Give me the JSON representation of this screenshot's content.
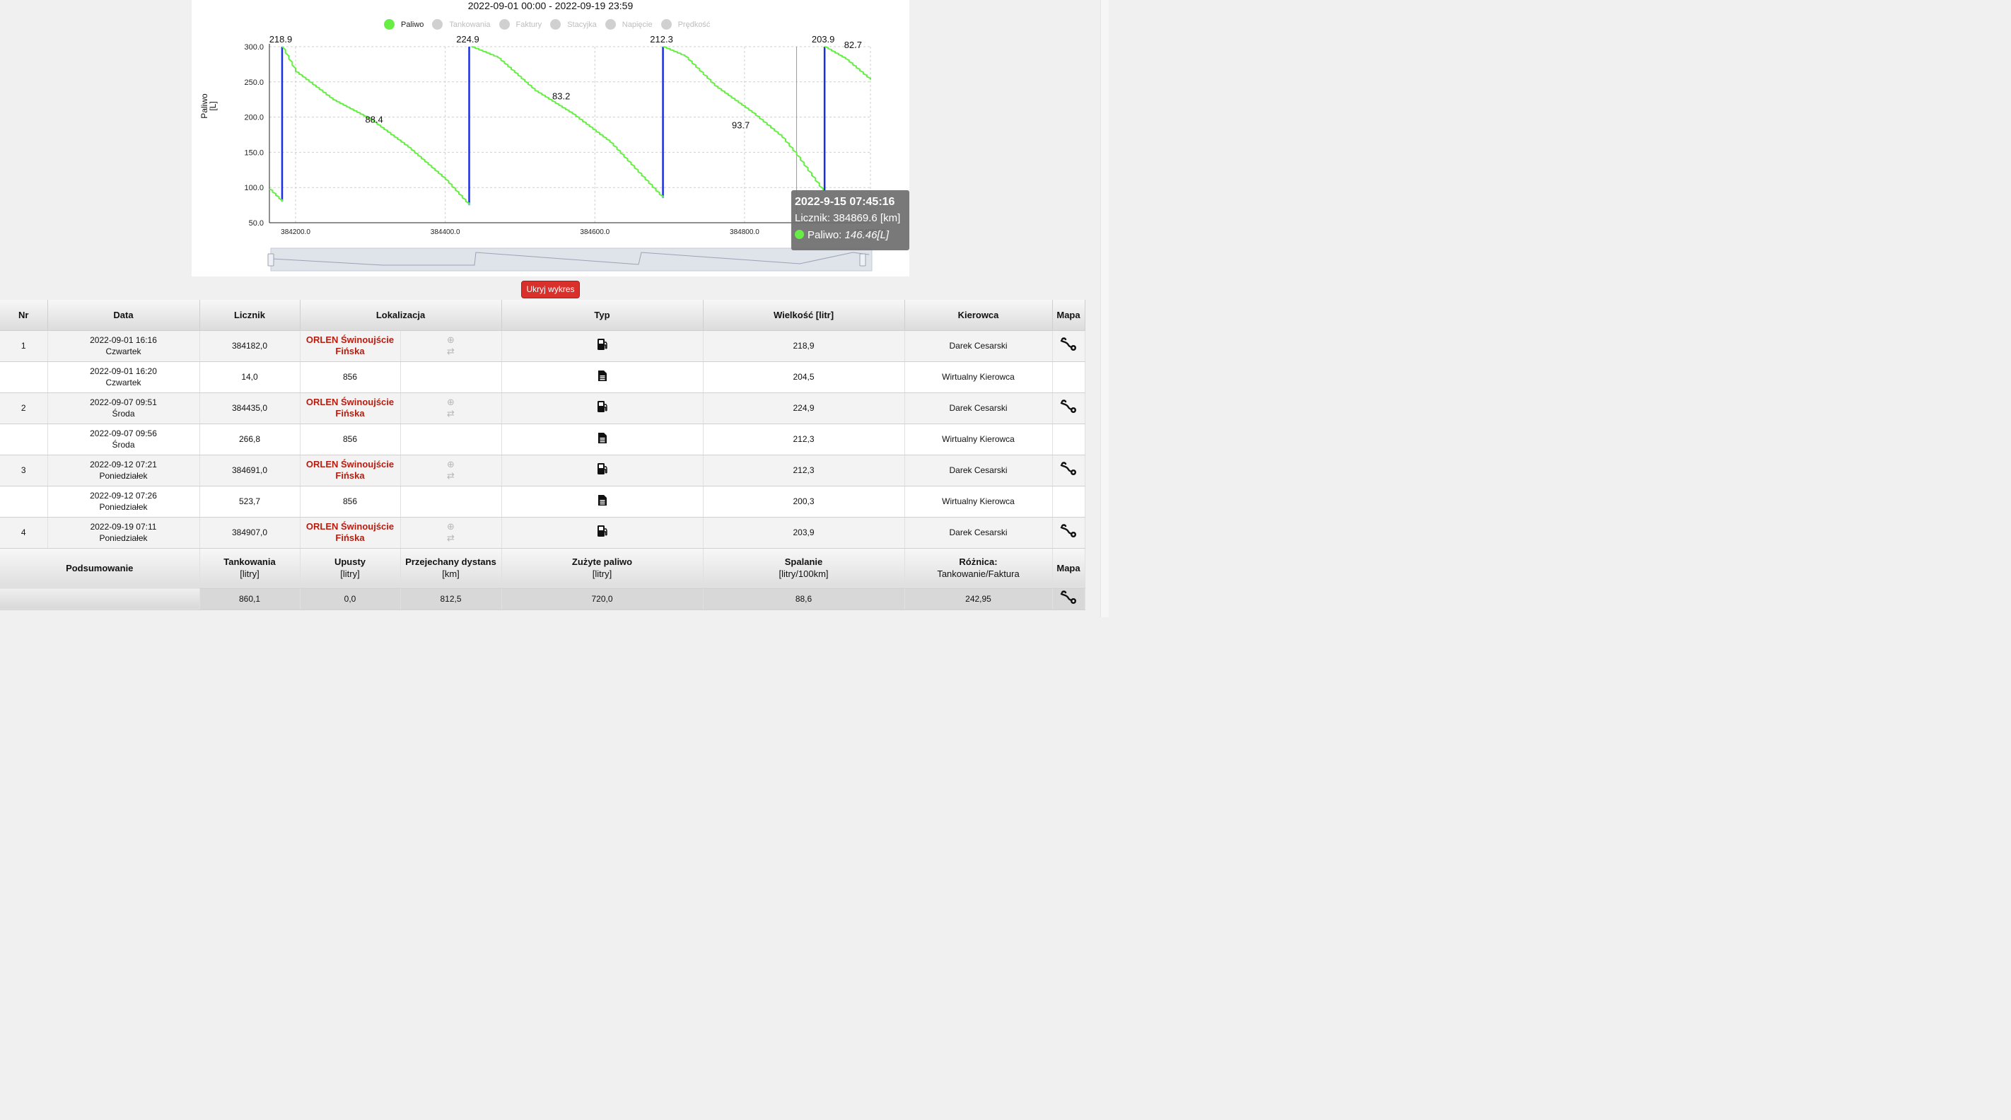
{
  "chart": {
    "title": "2022-09-01 00:00 - 2022-09-19 23:59",
    "legend": [
      {
        "label": "Paliwo",
        "active": true
      },
      {
        "label": "Tankowania",
        "active": false
      },
      {
        "label": "Faktury",
        "active": false
      },
      {
        "label": "Stacyjka",
        "active": false
      },
      {
        "label": "Napięcie",
        "active": false
      },
      {
        "label": "Prędkość",
        "active": false
      }
    ],
    "y_axis_title_line1": "Paliwo",
    "y_axis_title_line2": "[L]",
    "hide_button": "Ukryj wykres",
    "tooltip": {
      "title": "2022-9-15 07:45:16",
      "licznik": "Licznik: 384869.6 [km]",
      "paliwo_label": "Paliwo: ",
      "paliwo_value": "146.46[L]"
    }
  },
  "chart_data": {
    "type": "line",
    "xlabel": "",
    "ylabel": "Paliwo [L]",
    "xlim": [
      384165,
      384968.3
    ],
    "ylim": [
      50,
      300
    ],
    "xticks": [
      "384200.0",
      "384400.0",
      "384600.0",
      "384800.0",
      "384968.3"
    ],
    "yticks": [
      "50.0",
      "100.0",
      "150.0",
      "200.0",
      "250.0",
      "300.0"
    ],
    "series": [
      {
        "name": "Paliwo",
        "color": "#66ee44",
        "segments": [
          {
            "x": [
              384165,
              384182
            ],
            "y": [
              98,
              80
            ]
          },
          {
            "x": [
              384182,
              384200,
              384250,
              384300,
              384350,
              384400,
              384432
            ],
            "y": [
              300,
              265,
              225,
              197,
              158,
              112,
              75
            ]
          },
          {
            "x": [
              384435,
              384470,
              384520,
              384570,
              384620,
              384691
            ],
            "y": [
              300,
              285,
              238,
              205,
              165,
              85
            ]
          },
          {
            "x": [
              384691,
              384720,
              384760,
              384810,
              384850,
              384869.6,
              384905
            ],
            "y": [
              300,
              287,
              245,
              207,
              172,
              146.46,
              95
            ]
          },
          {
            "x": [
              384907,
              384935,
              384968.3
            ],
            "y": [
              300,
              283,
              253
            ]
          }
        ]
      }
    ],
    "refuel_lines": [
      {
        "x": 384182,
        "y0": 80,
        "y1": 300,
        "label": "218.9"
      },
      {
        "x": 384432,
        "y0": 75,
        "y1": 300,
        "label": "224.9"
      },
      {
        "x": 384691,
        "y0": 85,
        "y1": 300,
        "label": "212.3"
      },
      {
        "x": 384907,
        "y0": 95,
        "y1": 300,
        "label": "203.9"
      }
    ],
    "segment_labels": [
      {
        "x": 384305,
        "y": 192,
        "label": "88.4"
      },
      {
        "x": 384555,
        "y": 225,
        "label": "83.2"
      },
      {
        "x": 384795,
        "y": 184,
        "label": "93.7"
      },
      {
        "x": 384945,
        "y": 298,
        "label": "82.7"
      }
    ],
    "grid": true
  },
  "table": {
    "headers": [
      "Nr",
      "Data",
      "Licznik",
      "Lokalizacja",
      "Typ",
      "Wielkość [litr]",
      "Kierowca",
      "Mapa"
    ],
    "rows": [
      {
        "nr": "1",
        "date": "2022-09-01 16:16",
        "day": "Czwartek",
        "licznik": "384182,0",
        "loc1": "ORLEN Świnoujście",
        "loc2": "Fińska",
        "typ": "pump",
        "wielkosc": "218,9",
        "kierowca": "Darek Cesarski",
        "map": true
      },
      {
        "nr": "",
        "date": "2022-09-01 16:20",
        "day": "Czwartek",
        "licznik": "14,0",
        "loc1": "856",
        "loc2": "",
        "typ": "doc",
        "wielkosc": "204,5",
        "kierowca": "Wirtualny Kierowca",
        "map": false
      },
      {
        "nr": "2",
        "date": "2022-09-07 09:51",
        "day": "Środa",
        "licznik": "384435,0",
        "loc1": "ORLEN Świnoujście",
        "loc2": "Fińska",
        "typ": "pump",
        "wielkosc": "224,9",
        "kierowca": "Darek Cesarski",
        "map": true
      },
      {
        "nr": "",
        "date": "2022-09-07 09:56",
        "day": "Środa",
        "licznik": "266,8",
        "loc1": "856",
        "loc2": "",
        "typ": "doc",
        "wielkosc": "212,3",
        "kierowca": "Wirtualny Kierowca",
        "map": false
      },
      {
        "nr": "3",
        "date": "2022-09-12 07:21",
        "day": "Poniedziałek",
        "licznik": "384691,0",
        "loc1": "ORLEN Świnoujście",
        "loc2": "Fińska",
        "typ": "pump",
        "wielkosc": "212,3",
        "kierowca": "Darek Cesarski",
        "map": true
      },
      {
        "nr": "",
        "date": "2022-09-12 07:26",
        "day": "Poniedziałek",
        "licznik": "523,7",
        "loc1": "856",
        "loc2": "",
        "typ": "doc",
        "wielkosc": "200,3",
        "kierowca": "Wirtualny Kierowca",
        "map": false
      },
      {
        "nr": "4",
        "date": "2022-09-19 07:11",
        "day": "Poniedziałek",
        "licznik": "384907,0",
        "loc1": "ORLEN Świnoujście",
        "loc2": "Fińska",
        "typ": "pump",
        "wielkosc": "203,9",
        "kierowca": "Darek Cesarski",
        "map": true
      }
    ],
    "summary": {
      "label": "Podsumowanie",
      "cols": [
        {
          "title": "Tankowania",
          "unit": "[litry]",
          "value": "860,1"
        },
        {
          "title": "Upusty",
          "unit": "[litry]",
          "value": "0,0"
        },
        {
          "title": "Przejechany dystans",
          "unit": "[km]",
          "value": "812,5"
        },
        {
          "title": "Zużyte paliwo",
          "unit": "[litry]",
          "value": "720,0"
        },
        {
          "title": "Spalanie",
          "unit": "[litry/100km]",
          "value": "88,6"
        },
        {
          "title": "Różnica:",
          "unit": "Tankowanie/Faktura",
          "value": "242,95"
        }
      ],
      "map_label": "Mapa"
    }
  }
}
